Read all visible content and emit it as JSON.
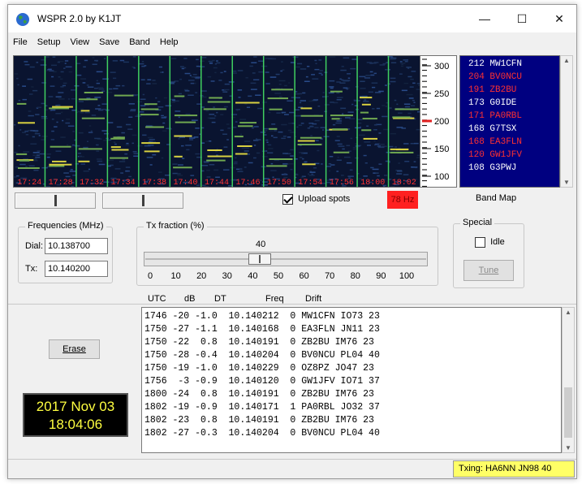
{
  "window": {
    "title": "WSPR 2.0    by K1JT",
    "minimize": "—",
    "maximize": "☐",
    "close": "✕"
  },
  "menu": [
    "File",
    "Setup",
    "View",
    "Save",
    "Band",
    "Help"
  ],
  "waterfall": {
    "times": [
      "17:24",
      "17:28",
      "17:32",
      "17:34",
      "17:38",
      "17:40",
      "17:44",
      "17:46",
      "17:50",
      "17:54",
      "17:56",
      "18:00",
      "18:02"
    ],
    "scale_ticks": [
      "300",
      "250",
      "200",
      "150",
      "100"
    ],
    "time_label_color": "#ff3030",
    "background": "#0a1430",
    "divider_color": "#40d060"
  },
  "band_calls": [
    {
      "snr": "212",
      "call": "MW1CFN",
      "color": "#ffffff"
    },
    {
      "snr": "204",
      "call": "BV0NCU",
      "color": "#ff3030"
    },
    {
      "snr": "191",
      "call": "ZB2BU",
      "color": "#ff3030"
    },
    {
      "snr": "173",
      "call": "G0IDE",
      "color": "#ffffff"
    },
    {
      "snr": "171",
      "call": "PA0RBL",
      "color": "#ff3030"
    },
    {
      "snr": "168",
      "call": "G7TSX",
      "color": "#ffffff"
    },
    {
      "snr": "168",
      "call": "EA3FLN",
      "color": "#ff3030"
    },
    {
      "snr": "120",
      "call": "GW1JFV",
      "color": "#ff3030"
    },
    {
      "snr": "108",
      "call": "G3PWJ",
      "color": "#ffffff"
    }
  ],
  "controls": {
    "upload_spots": "Upload spots",
    "upload_checked": true,
    "drift_hz": "78 Hz",
    "band_map": "Band Map"
  },
  "frequencies": {
    "legend": "Frequencies (MHz)",
    "dial_label": "Dial:",
    "dial_value": "10.138700",
    "tx_label": "Tx:",
    "tx_value": "10.140200"
  },
  "tx_fraction": {
    "legend": "Tx fraction (%)",
    "value": "40",
    "ticks": [
      "0",
      "10",
      "20",
      "30",
      "40",
      "50",
      "60",
      "70",
      "80",
      "90",
      "100"
    ]
  },
  "special": {
    "legend": "Special",
    "idle": "Idle",
    "tune": "Tune"
  },
  "decode_headers": {
    "utc": "UTC",
    "db": "dB",
    "dt": "DT",
    "freq": "Freq",
    "drift": "Drift"
  },
  "decodes": [
    "1746 -20 -1.0  10.140212  0 MW1CFN IO73 23",
    "1750 -27 -1.1  10.140168  0 EA3FLN JN11 23",
    "1750 -22  0.8  10.140191  0 ZB2BU IM76 23",
    "1750 -28 -0.4  10.140204  0 BV0NCU PL04 40",
    "1750 -19 -1.0  10.140229  0 OZ8PZ JO47 23",
    "1756  -3 -0.9  10.140120  0 GW1JFV IO71 37",
    "1800 -24  0.8  10.140191  0 ZB2BU IM76 23",
    "1802 -19 -0.9  10.140171  1 PA0RBL JO32 37",
    "1802 -23  0.8  10.140191  0 ZB2BU IM76 23",
    "1802 -27 -0.3  10.140204  0 BV0NCU PL04 40"
  ],
  "erase": "Erase",
  "clock": {
    "date": "2017 Nov 03",
    "time": "18:04:06"
  },
  "status": {
    "txing": "Txing: HA6NN JN98 40"
  }
}
